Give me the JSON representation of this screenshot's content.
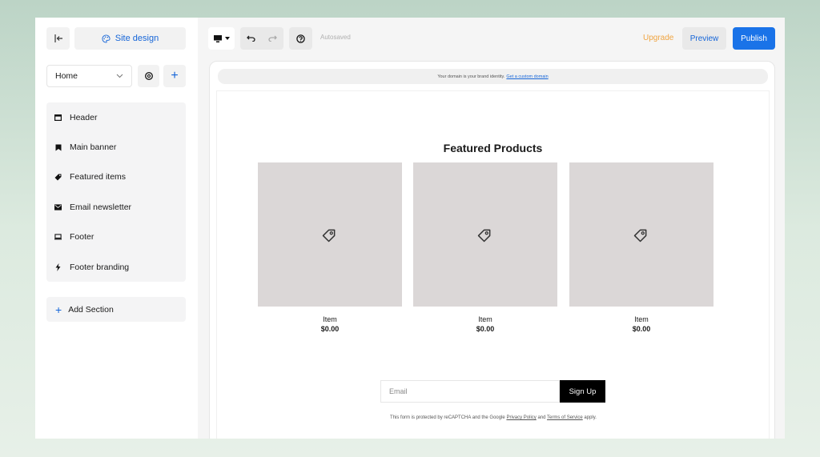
{
  "sidebar": {
    "site_design_label": "Site design",
    "page_select_value": "Home",
    "sections": [
      {
        "label": "Header",
        "icon": "header-icon"
      },
      {
        "label": "Main banner",
        "icon": "bookmark-icon"
      },
      {
        "label": "Featured items",
        "icon": "tag-icon"
      },
      {
        "label": "Email newsletter",
        "icon": "mail-icon"
      },
      {
        "label": "Footer",
        "icon": "footer-icon"
      },
      {
        "label": "Footer branding",
        "icon": "bolt-icon"
      }
    ],
    "add_section_label": "Add Section"
  },
  "toolbar": {
    "autosaved": "Autosaved",
    "upgrade": "Upgrade",
    "preview": "Preview",
    "publish": "Publish"
  },
  "canvas": {
    "domain_text": "Your domain is your brand identity.",
    "domain_link": "Get a custom domain",
    "featured_title": "Featured Products",
    "products": [
      {
        "name": "Item",
        "price": "$0.00"
      },
      {
        "name": "Item",
        "price": "$0.00"
      },
      {
        "name": "Item",
        "price": "$0.00"
      }
    ],
    "email_placeholder": "Email",
    "signup_label": "Sign Up",
    "recaptcha": {
      "prefix": "This form is protected by reCAPTCHA and the Google",
      "privacy": "Privacy Policy",
      "and": "and",
      "terms": "Terms of Service",
      "suffix": "apply."
    }
  },
  "colors": {
    "accent": "#1a73e8",
    "upgrade": "#f0a542",
    "product_placeholder": "#dbd7d7"
  }
}
